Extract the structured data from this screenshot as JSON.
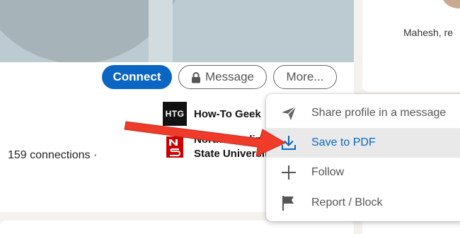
{
  "profile": {
    "buttons": {
      "connect": "Connect",
      "message": "Message",
      "more": "More..."
    },
    "companies": [
      {
        "logo_text": "HTG",
        "name": "How-To Geek"
      },
      {
        "logo_text": "",
        "name": "North Carolina State University"
      }
    ],
    "connections": "159 connections  ·"
  },
  "sidebar": {
    "name_snippet": "Mahesh, re"
  },
  "menu": {
    "items": [
      {
        "label": "Share profile in a message",
        "icon": "send-icon"
      },
      {
        "label": "Save to PDF",
        "icon": "download-icon"
      },
      {
        "label": "Follow",
        "icon": "plus-icon"
      },
      {
        "label": "Report / Block",
        "icon": "flag-icon"
      }
    ]
  },
  "colors": {
    "brand_blue": "#0a66c2",
    "highlight_bg": "#e9e9e9",
    "annotation_arrow": "#ee3b2a"
  }
}
